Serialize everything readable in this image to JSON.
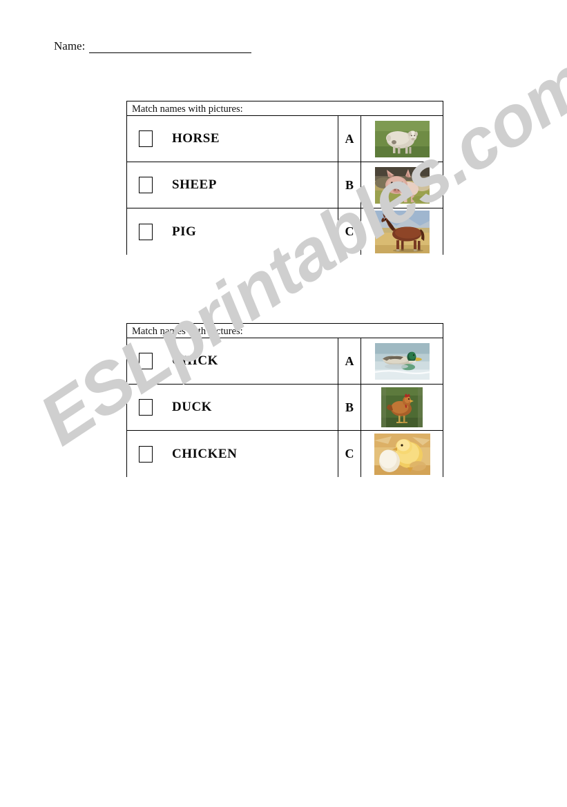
{
  "page": {
    "name_label": "Name:",
    "name_value": "",
    "watermark": "ESLprintables.com"
  },
  "exercises": [
    {
      "id": "exercise-1",
      "header": "Match names with pictures:",
      "rows": [
        {
          "checkbox": "",
          "word": "HORSE",
          "letter": "A",
          "picture": "sheep-photo",
          "picture_alt": "sheep standing on green grass"
        },
        {
          "checkbox": "",
          "word": "SHEEP",
          "letter": "B",
          "picture": "pig-photo",
          "picture_alt": "pink pig in a field"
        },
        {
          "checkbox": "",
          "word": "PIG",
          "letter": "C",
          "picture": "horse-photo",
          "picture_alt": "brown horse in a golden field"
        }
      ]
    },
    {
      "id": "exercise-2",
      "header": "Match names with pictures:",
      "rows": [
        {
          "checkbox": "",
          "word": "CHICK",
          "letter": "A",
          "picture": "duck-photo",
          "picture_alt": "mallard duck swimming on water"
        },
        {
          "checkbox": "",
          "word": "DUCK",
          "letter": "B",
          "picture": "chicken-photo",
          "picture_alt": "brown hen on grass"
        },
        {
          "checkbox": "",
          "word": "CHICKEN",
          "letter": "C",
          "picture": "chick-photo",
          "picture_alt": "yellow chick beside a white egg"
        }
      ]
    }
  ],
  "colors": {
    "ink": "#000000",
    "watermark": "#cfcfcf",
    "paper": "#ffffff"
  }
}
